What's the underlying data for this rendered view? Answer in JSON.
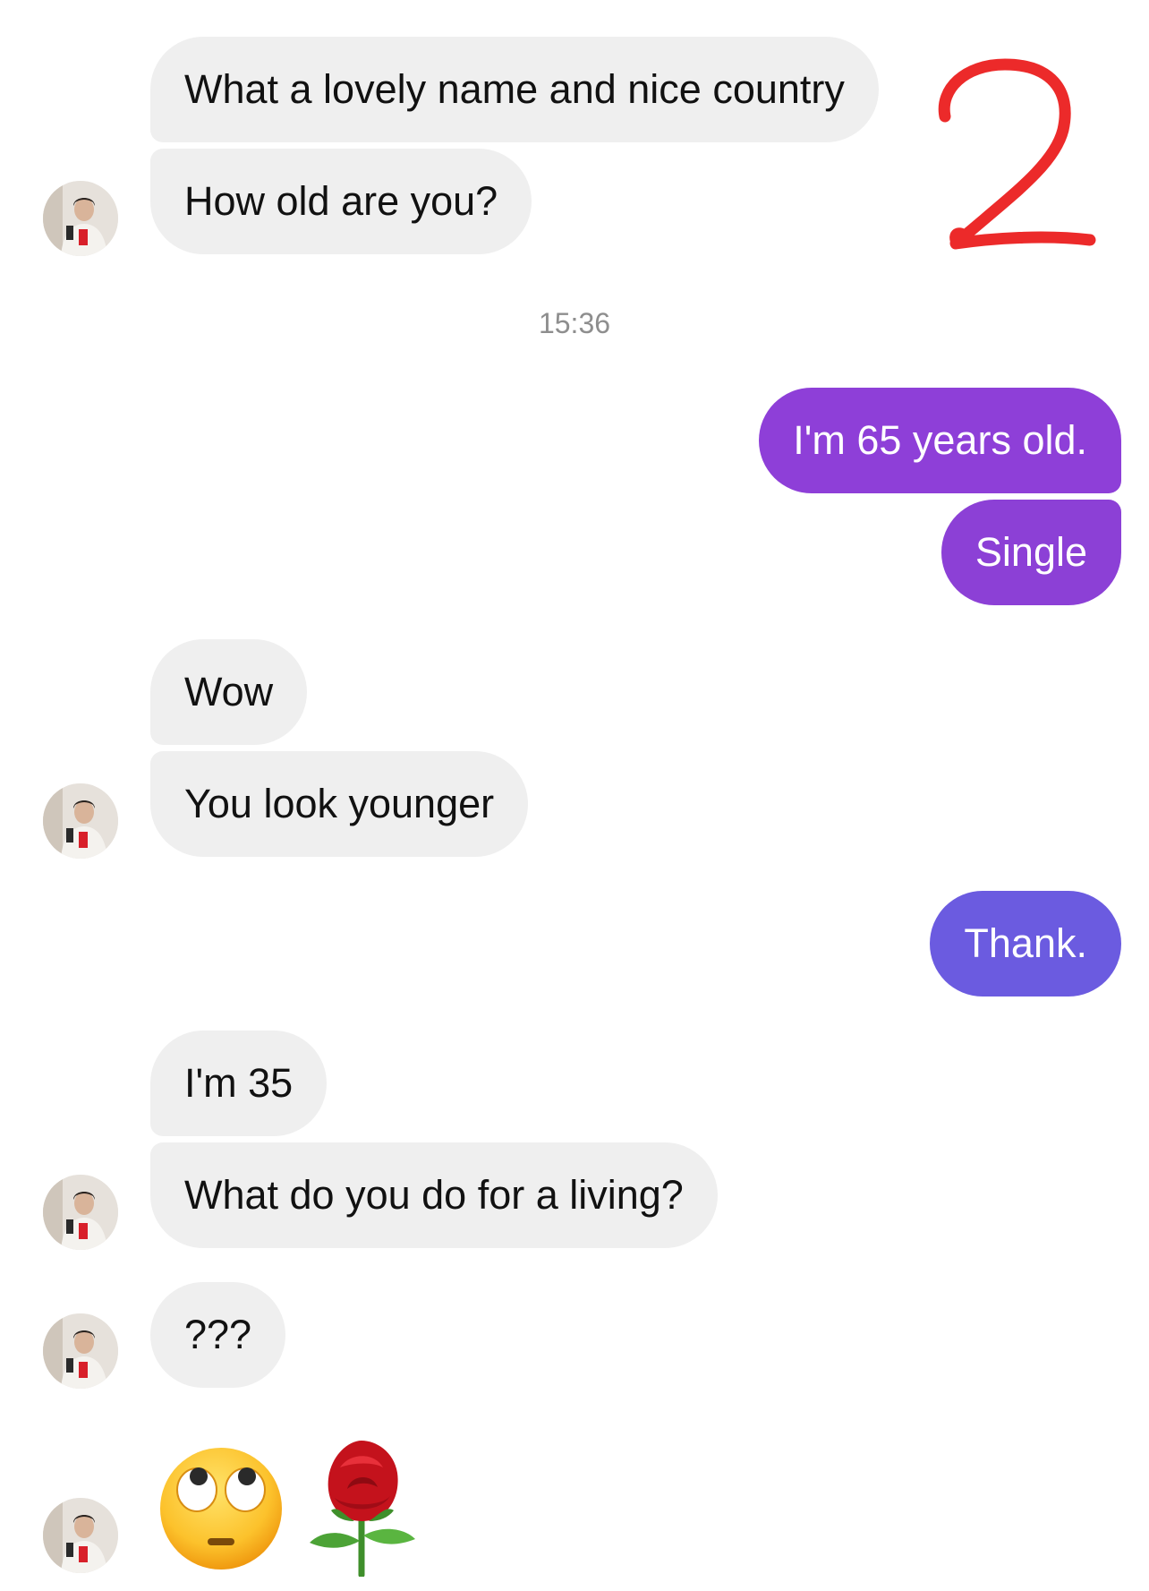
{
  "colors": {
    "incoming_bubble": "#efefef",
    "outgoing_bubble_1": "#8e3fd8",
    "outgoing_bubble_2": "#8c40d6",
    "outgoing_bubble_3": "#6b5be0",
    "annotation_red": "#ec2a2a",
    "timestamp_gray": "#8e8e8e"
  },
  "annotation": {
    "text": "2"
  },
  "timestamp": "15:36",
  "messages": [
    {
      "side": "incoming",
      "text": "What a lovely name and nice country"
    },
    {
      "side": "incoming",
      "text": "How old are you?"
    },
    {
      "side": "outgoing",
      "text": "I'm 65 years old."
    },
    {
      "side": "outgoing",
      "text": "Single"
    },
    {
      "side": "incoming",
      "text": "Wow"
    },
    {
      "side": "incoming",
      "text": "You look younger"
    },
    {
      "side": "outgoing",
      "text": "Thank."
    },
    {
      "side": "incoming",
      "text": "I'm 35"
    },
    {
      "side": "incoming",
      "text": "What do you do for a living?"
    },
    {
      "side": "incoming",
      "text": "???"
    }
  ],
  "reactions": {
    "emoji_1": "face-with-rolling-eyes",
    "emoji_2": "rose"
  },
  "icons": {
    "avatar": "contact-avatar-photo"
  }
}
